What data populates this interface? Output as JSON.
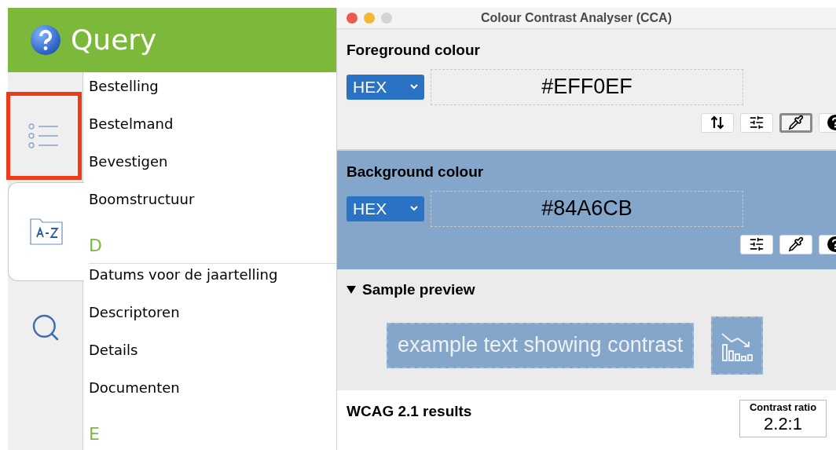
{
  "app": {
    "title": "Query",
    "tabs": [
      {
        "kind": "list",
        "selected": false,
        "highlighted": true
      },
      {
        "kind": "az",
        "selected": true,
        "highlighted": false
      },
      {
        "kind": "search",
        "selected": false,
        "highlighted": false
      }
    ],
    "index": [
      {
        "kind": "item",
        "text": "Bestelling"
      },
      {
        "kind": "item",
        "text": "Bestelmand"
      },
      {
        "kind": "item",
        "text": "Bevestigen"
      },
      {
        "kind": "item",
        "text": "Boomstructuur"
      },
      {
        "kind": "letter",
        "text": "D"
      },
      {
        "kind": "item",
        "text": "Datums voor de jaartelling"
      },
      {
        "kind": "item",
        "text": "Descriptoren"
      },
      {
        "kind": "item",
        "text": "Details"
      },
      {
        "kind": "item",
        "text": "Documenten"
      },
      {
        "kind": "letter",
        "text": "E"
      }
    ]
  },
  "cca": {
    "title": "Colour Contrast Analyser (CCA)",
    "sections": [
      {
        "kind": "foreground",
        "heading": "Foreground colour",
        "format": "HEX",
        "value": "#EFF0EF",
        "tools": [
          {
            "kind": "swap",
            "pressed": false
          },
          {
            "kind": "sliders",
            "pressed": false
          },
          {
            "kind": "picker",
            "pressed": true
          },
          {
            "kind": "help",
            "pressed": false
          }
        ]
      },
      {
        "kind": "background",
        "heading": "Background colour",
        "format": "HEX",
        "value": "#84A6CB",
        "tools": [
          {
            "kind": "sliders",
            "pressed": false
          },
          {
            "kind": "picker",
            "pressed": false
          },
          {
            "kind": "help",
            "pressed": false
          }
        ]
      }
    ],
    "preview": {
      "heading": "Sample preview",
      "expanded": true,
      "sample": "example text showing contrast"
    },
    "results": {
      "heading": "WCAG 2.1 results",
      "ratio_label": "Contrast ratio",
      "ratio": "2.2:1"
    }
  }
}
